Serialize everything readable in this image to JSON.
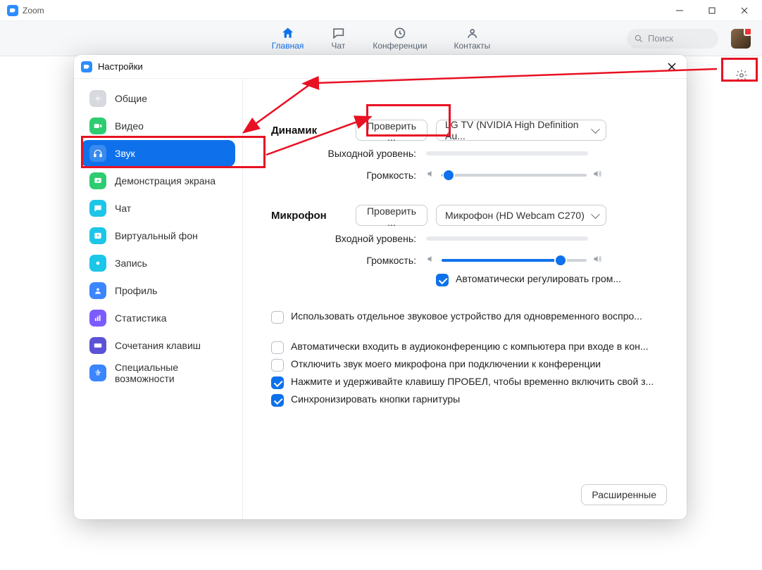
{
  "window": {
    "title": "Zoom"
  },
  "nav": {
    "home": "Главная",
    "chat": "Чат",
    "meetings": "Конференции",
    "contacts": "Контакты"
  },
  "search": {
    "placeholder": "Поиск"
  },
  "settings": {
    "title": "Настройки",
    "sidebar": {
      "general": "Общие",
      "video": "Видео",
      "audio": "Звук",
      "share_screen": "Демонстрация экрана",
      "chat": "Чат",
      "virtual_bg": "Виртуальный фон",
      "recording": "Запись",
      "profile": "Профиль",
      "statistics": "Статистика",
      "shortcuts": "Сочетания клавиш",
      "accessibility": "Специальные возможности"
    },
    "audio": {
      "speaker": {
        "label": "Динамик",
        "test": "Проверить ...",
        "device": "LG TV (NVIDIA High Definition Au...",
        "output_level": "Выходной уровень:",
        "volume": "Громкость:",
        "volume_pct": 5
      },
      "microphone": {
        "label": "Микрофон",
        "test": "Проверить ...",
        "device": "Микрофон (HD Webcam C270)",
        "input_level": "Входной уровень:",
        "volume": "Громкость:",
        "volume_pct": 82,
        "auto_adjust": "Автоматически регулировать гром..."
      },
      "checkboxes": {
        "separate_device": "Использовать отдельное звуковое устройство для одновременного воспро...",
        "auto_join_audio": "Автоматически входить в аудиоконференцию с компьютера при входе в кон...",
        "mute_on_join": "Отключить звук моего микрофона при подключении к конференции",
        "hold_space": "Нажмите и удерживайте клавишу ПРОБЕЛ, чтобы временно включить свой з...",
        "sync_headset": "Синхронизировать кнопки гарнитуры"
      },
      "advanced": "Расширенные"
    }
  }
}
